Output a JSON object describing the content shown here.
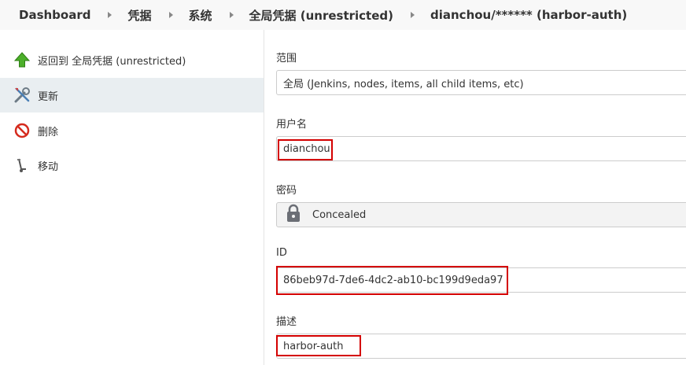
{
  "breadcrumb": [
    "Dashboard",
    "凭据",
    "系统",
    "全局凭据 (unrestricted)",
    "dianchou/****** (harbor-auth)"
  ],
  "sidebar": {
    "items": [
      {
        "label": "返回到 全局凭据 (unrestricted)",
        "icon": "up-arrow-icon"
      },
      {
        "label": "更新",
        "icon": "tools-icon"
      },
      {
        "label": "删除",
        "icon": "no-entry-icon"
      },
      {
        "label": "移动",
        "icon": "move-icon"
      }
    ]
  },
  "form": {
    "scope_label": "范围",
    "scope_value": "全局 (Jenkins, nodes, items, all child items, etc)",
    "username_label": "用户名",
    "username_value": "dianchou",
    "password_label": "密码",
    "password_value": "Concealed",
    "id_label": "ID",
    "id_value": "86beb97d-7de6-4dc2-ab10-bc199d9eda97",
    "description_label": "描述",
    "description_value": "harbor-auth"
  },
  "colors": {
    "highlight": "#d40000",
    "active_bg": "#e9eef1"
  }
}
